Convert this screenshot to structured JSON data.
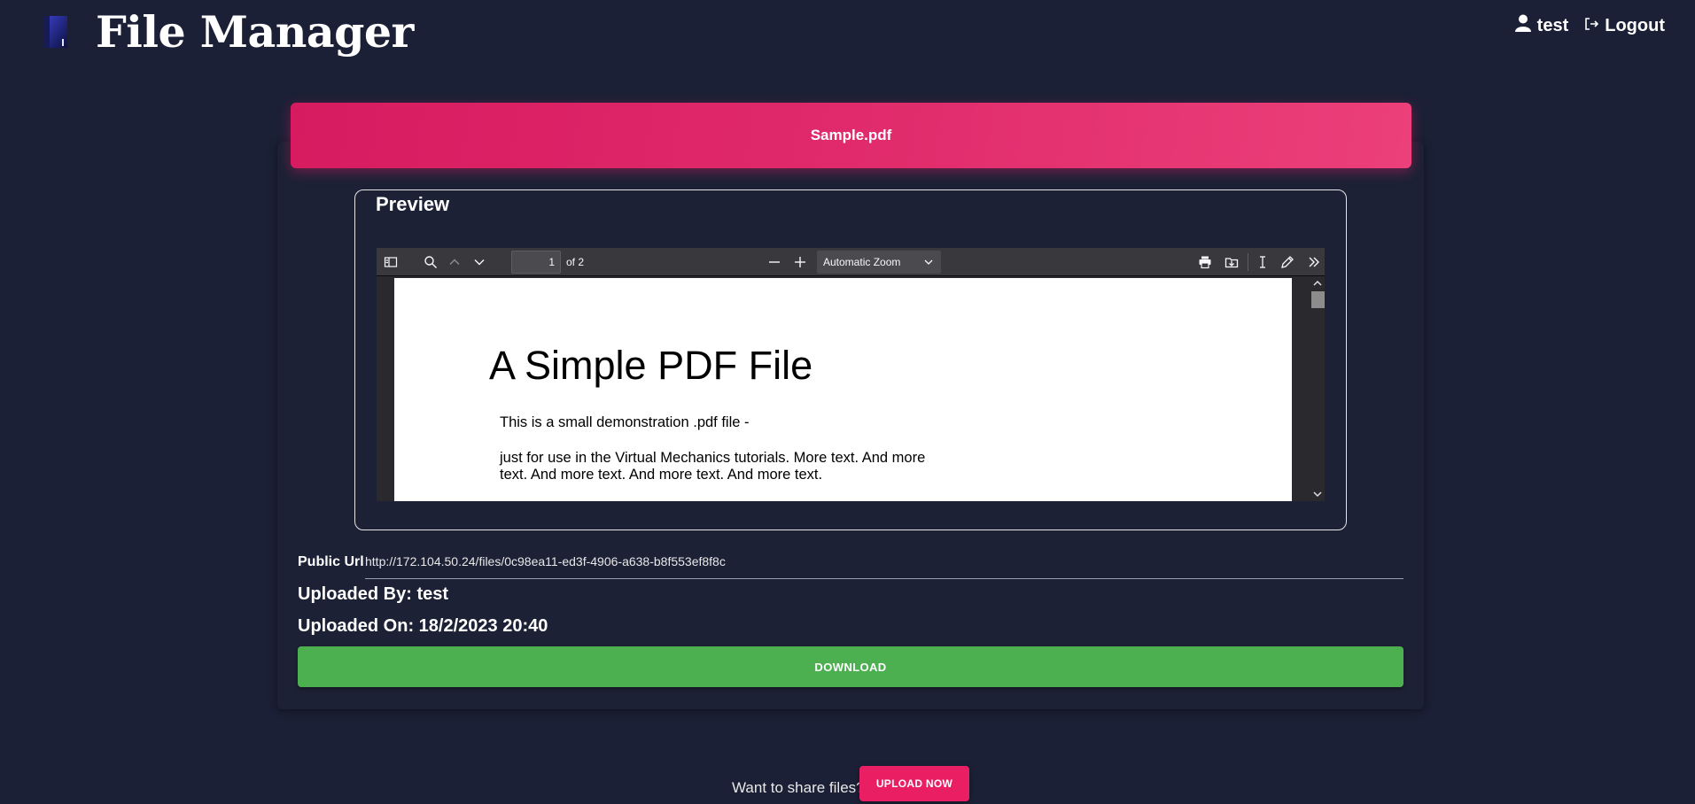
{
  "header": {
    "title": "File Manager",
    "user_name": "test",
    "logout_label": "Logout",
    "logo_icon": "file-manager-logo",
    "user_icon": "user-icon",
    "logout_icon": "logout-icon"
  },
  "file": {
    "name": "Sample.pdf",
    "preview_title": "Preview"
  },
  "viewer": {
    "page_value": "1",
    "page_count": "of 2",
    "zoom": "Automatic Zoom",
    "page_content": {
      "heading": "A Simple PDF File",
      "lines": [
        "This is a small demonstration .pdf file -",
        "just for use in the Virtual Mechanics tutorials. More text. And more",
        "text. And more text. And more text. And more text."
      ]
    }
  },
  "details": {
    "public_url_label": "Public Url",
    "public_url": "http://172.104.50.24/files/0c98ea11-ed3f-4906-a638-b8f553ef8f8c",
    "uploaded_by": "Uploaded By: test",
    "uploaded_on": "Uploaded On: 18/2/2023 20:40",
    "download_label": "DOWNLOAD"
  },
  "footer": {
    "share_text": "Want to share files?",
    "upload_label": "UPLOAD NOW"
  },
  "colors": {
    "background": "#1b2036",
    "header_accent": "#d81b60",
    "download": "#4caf50",
    "upload": "#e91e63"
  }
}
